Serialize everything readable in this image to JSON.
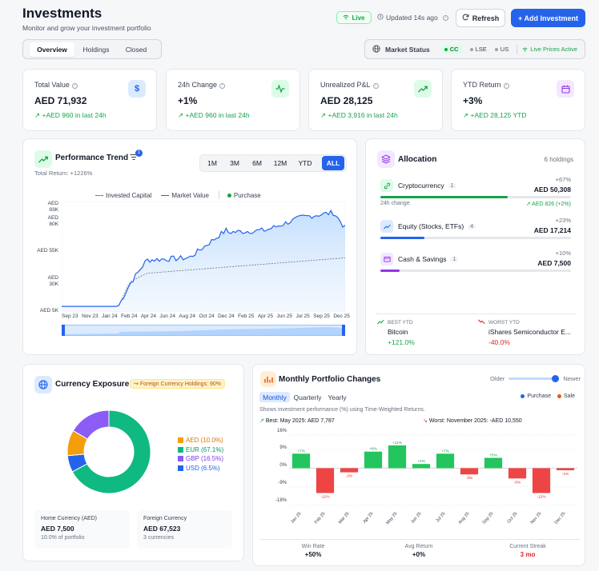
{
  "header": {
    "title": "Investments",
    "subtitle": "Monitor and grow your investment portfolio",
    "live_label": "Live",
    "updated_label": "Updated 14s ago",
    "refresh_label": "Refresh",
    "add_label": "+ Add Investment"
  },
  "tabs": [
    {
      "label": "Overview",
      "active": true
    },
    {
      "label": "Holdings",
      "active": false
    },
    {
      "label": "Closed",
      "active": false
    }
  ],
  "market": {
    "label": "Market Status",
    "markets": [
      "CC",
      "LSE",
      "US"
    ],
    "live_prices": "Live Prices Active"
  },
  "stats": [
    {
      "label": "Total Value",
      "value": "AED 71,932",
      "change": "+AED 960 in last 24h",
      "icon": "dollar-icon"
    },
    {
      "label": "24h Change",
      "value": "+1%",
      "change": "+AED 960 in last 24h",
      "icon": "pulse-icon"
    },
    {
      "label": "Unrealized P&L",
      "value": "AED 28,125",
      "change": "+AED 3,916 in last 24h",
      "icon": "trending-up-icon"
    },
    {
      "label": "YTD Return",
      "value": "+3%",
      "change": "+AED 28,125 YTD",
      "icon": "calendar-icon"
    }
  ],
  "performance": {
    "title": "Performance Trend",
    "badge": "1",
    "total_return": "Total Return: +1226%",
    "ranges": [
      "1M",
      "3M",
      "6M",
      "12M",
      "YTD",
      "ALL"
    ],
    "active_range": "ALL",
    "legend": [
      "Invested Capital",
      "Market Value",
      "Purchase"
    ],
    "y_ticks": [
      {
        "l1": "AED",
        "l2": "93K"
      },
      {
        "l1": "AED",
        "l2": "80K"
      },
      {
        "l1": "AED 55K",
        "l2": ""
      },
      {
        "l1": "AED",
        "l2": "30K"
      },
      {
        "l1": "AED 5K",
        "l2": ""
      }
    ],
    "x_ticks": [
      "Sep 23",
      "Nov 23",
      "Jan 24",
      "Feb 24",
      "Apr 24",
      "Jun 24",
      "Aug 24",
      "Oct 24",
      "Dec 24",
      "Feb 25",
      "Apr 25",
      "Jun 25",
      "Jul 25",
      "Sep 25",
      "Dec 25"
    ]
  },
  "allocation": {
    "title": "Allocation",
    "count": "6 holdings",
    "items": [
      {
        "name": "Cryptocurrency",
        "count": "1",
        "pct": "+67%",
        "value": "AED 50,308",
        "fill": 0.67,
        "color": "#16a34a",
        "sub_left": "24h change",
        "sub_right": "AED 826 (+2%)"
      },
      {
        "name": "Equity (Stocks, ETFs)",
        "count": "4",
        "pct": "+23%",
        "value": "AED 17,214",
        "fill": 0.23,
        "color": "#2563eb",
        "sub_left": "",
        "sub_right": ""
      },
      {
        "name": "Cash & Savings",
        "count": "1",
        "pct": "+10%",
        "value": "AED 7,500",
        "fill": 0.1,
        "color": "#9333ea",
        "sub_left": "",
        "sub_right": ""
      }
    ],
    "best": {
      "label": "BEST YTD",
      "name": "Bitcoin",
      "value": "+121.0%"
    },
    "worst": {
      "label": "WORST YTD",
      "name": "iShares Semiconductor E...",
      "value": "-40.0%"
    }
  },
  "currency": {
    "title": "Currency Exposure",
    "badge": "Foreign Currency Holdings: 90%",
    "legend": [
      "AED (10.0%)",
      "EUR (67.1%)",
      "GBP (16.5%)",
      "USD (6.5%)"
    ],
    "home_label": "Home Currency (AED)",
    "home_value": "AED 7,500",
    "home_sub": "10.0% of portfolio",
    "foreign_label": "Foreign Currency",
    "foreign_value": "AED 67,523",
    "foreign_sub": "3 currencies"
  },
  "monthly": {
    "title": "Monthly Portfolio Changes",
    "older": "Older",
    "newer": "Newer",
    "tabs": [
      "Monthly",
      "Quarterly",
      "Yearly"
    ],
    "legend_purchase": "Purchase",
    "legend_sale": "Sale",
    "note": "Shows investment performance (%) using Time-Weighted Returns.",
    "best": "Best: May 2025: AED 7,787",
    "worst": "Worst: November 2025: -AED 10,550",
    "footer": [
      {
        "label": "Win Rate",
        "value": "+50%",
        "color": "#111827"
      },
      {
        "label": "Avg Return",
        "value": "+0%",
        "color": "#111827"
      },
      {
        "label": "Current Streak",
        "value": "3 mo",
        "color": "#dc2626"
      }
    ]
  },
  "chart_data": [
    {
      "type": "pie",
      "title": "Currency Exposure",
      "categories": [
        "AED",
        "EUR",
        "GBP",
        "USD"
      ],
      "values": [
        10.0,
        67.1,
        16.5,
        6.5
      ],
      "colors": [
        "#f59e0b",
        "#10b981",
        "#8b5cf6",
        "#2563eb"
      ]
    },
    {
      "type": "bar",
      "title": "Monthly Portfolio Changes",
      "categories": [
        "Jan 25",
        "Feb 25",
        "Mar 25",
        "Apr 25",
        "May 25",
        "Jun 25",
        "Jul 25",
        "Aug 25",
        "Sep 25",
        "Oct 25",
        "Nov 25",
        "Dec 25"
      ],
      "values": [
        7,
        -12,
        -2,
        8,
        11,
        2,
        7,
        -3,
        5,
        -5,
        -12,
        -1
      ],
      "labels": [
        "+7%",
        "-12%",
        "-2%",
        "+8%",
        "+11%",
        "+2%",
        "+7%",
        "-3%",
        "+5%",
        "-5%",
        "-12%",
        "-1%"
      ],
      "y_ticks": [
        "16%",
        "9%",
        "0%",
        "-9%",
        "-18%"
      ],
      "ylim": [
        -18,
        16
      ]
    }
  ]
}
